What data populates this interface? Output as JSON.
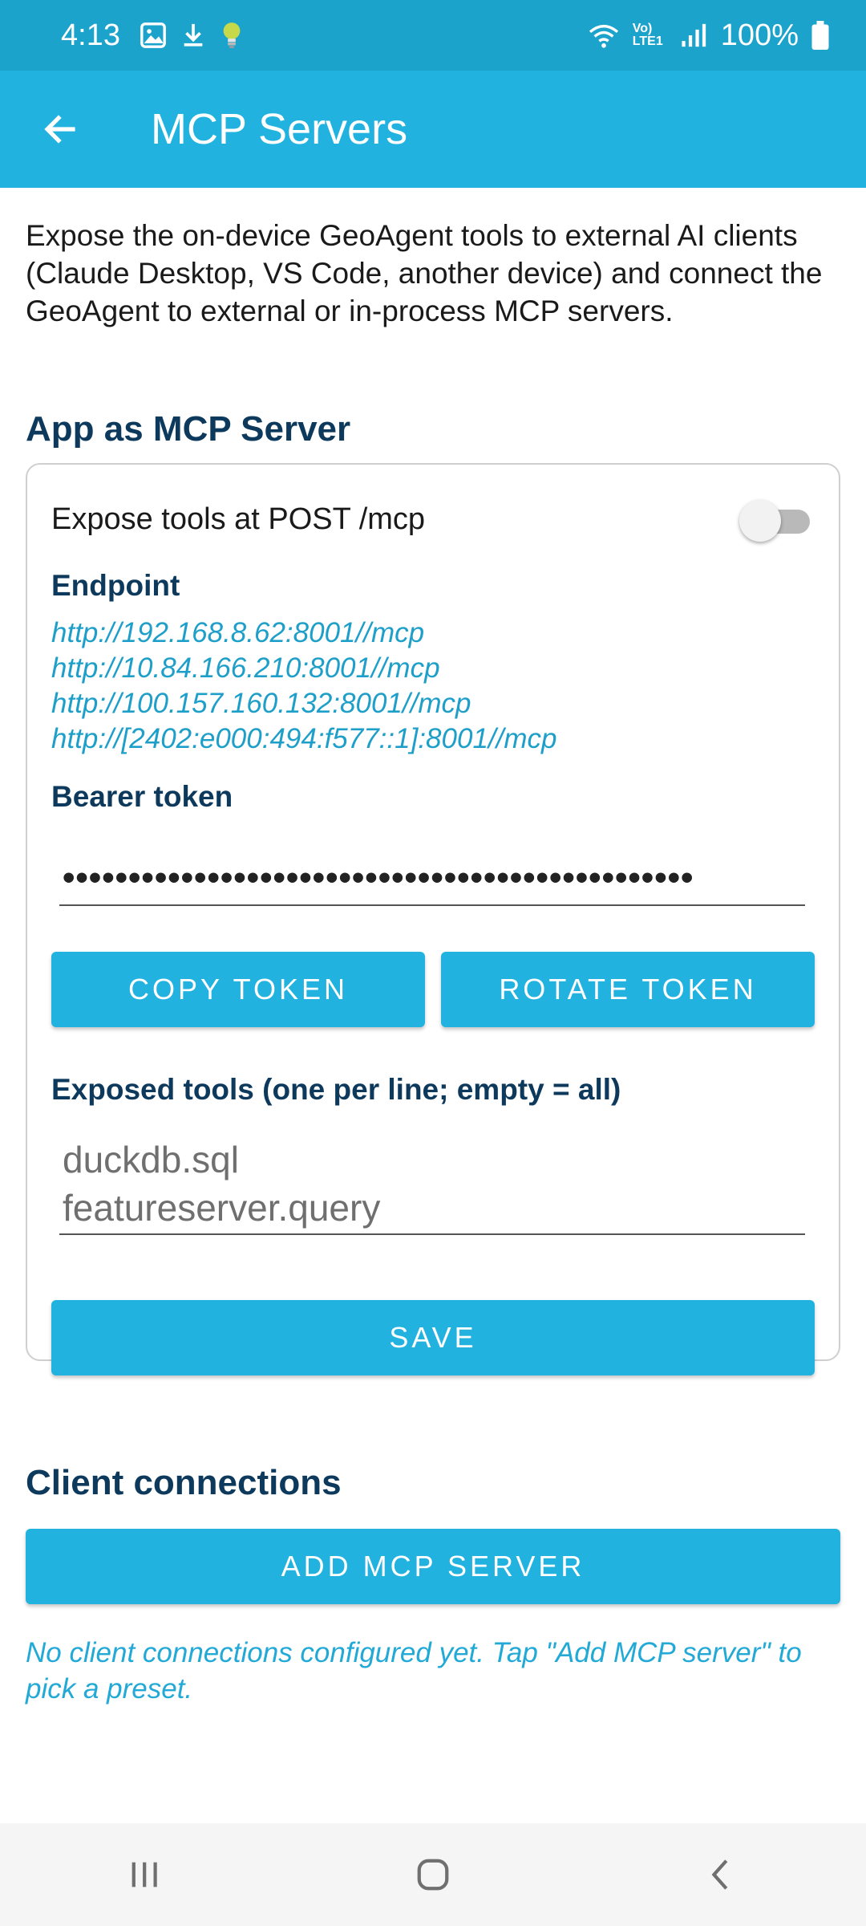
{
  "status_bar": {
    "time": "4:13",
    "icons_left": [
      "gallery-icon",
      "download-icon",
      "lightbulb-icon"
    ],
    "network_label": "Vo) LTE1",
    "battery": "100%"
  },
  "app_bar": {
    "title": "MCP Servers",
    "back_icon": "arrow-back-icon"
  },
  "intro_text": "Expose the on-device GeoAgent tools to external AI clients (Claude Desktop, VS Code, another device) and connect the GeoAgent to external or in-process MCP servers.",
  "server_section": {
    "title": "App as MCP Server",
    "expose_label": "Expose tools at POST /mcp",
    "expose_enabled": false,
    "endpoint_label": "Endpoint",
    "endpoints": [
      "http://192.168.8.62:8001//mcp",
      "http://10.84.166.210:8001//mcp",
      "http://100.157.160.132:8001//mcp",
      "http://[2402:e000:494:f577::1]:8001//mcp"
    ],
    "token_label": "Bearer token",
    "token_masked": "••••••••••••••••••••••••••••••••••••••••••••••••",
    "copy_token_label": "COPY TOKEN",
    "rotate_token_label": "ROTATE TOKEN",
    "tools_label": "Exposed tools (one per line; empty = all)",
    "tools_placeholder_line1": "duckdb.sql",
    "tools_placeholder_line2": "featureserver.query",
    "save_label": "SAVE"
  },
  "client_section": {
    "title": "Client connections",
    "add_button_label": "ADD MCP SERVER",
    "empty_message": "No client connections configured yet. Tap \"Add MCP server\" to pick a preset."
  },
  "nav_bar": {
    "icons": [
      "recent-apps-icon",
      "home-icon",
      "back-nav-icon"
    ]
  },
  "colors": {
    "status_bar": "#1ba3cc",
    "app_bar": "#22b2df",
    "accent": "#22b2df",
    "heading": "#0d3a5c",
    "link": "#1e9fc9"
  }
}
